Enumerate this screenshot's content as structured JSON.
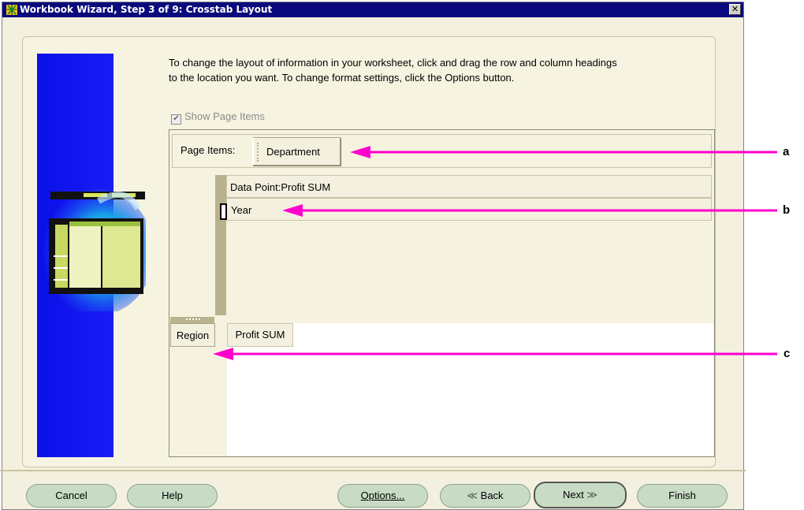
{
  "window": {
    "title": "Workbook Wizard, Step 3 of 9: Crosstab Layout",
    "close_glyph": "✕"
  },
  "instructions": {
    "line1": "To change the layout of information in your worksheet, click and drag the row and column headings",
    "line2": "to the location you want.  To change format settings, click the Options button."
  },
  "show_page_items": {
    "label": "Show Page Items",
    "checked": true,
    "check_glyph": "✔"
  },
  "page_items": {
    "label": "Page Items:",
    "items": [
      "Department"
    ]
  },
  "data_point": {
    "label": "Data Point:Profit SUM"
  },
  "row_headers": [
    "Year"
  ],
  "column_headers": [
    "Region"
  ],
  "data_cells": [
    "Profit SUM"
  ],
  "callouts": [
    "a",
    "b",
    "c"
  ],
  "buttons": {
    "cancel": "Cancel",
    "help": "Help",
    "options": "Options...",
    "back": "Back",
    "back_glyph": "≪",
    "next": "Next",
    "next_glyph": "≫",
    "finish": "Finish"
  },
  "colors": {
    "accent_blue": "#1a1cf5",
    "callout_magenta": "#ff00cc",
    "button_green": "#c8dcc5"
  }
}
